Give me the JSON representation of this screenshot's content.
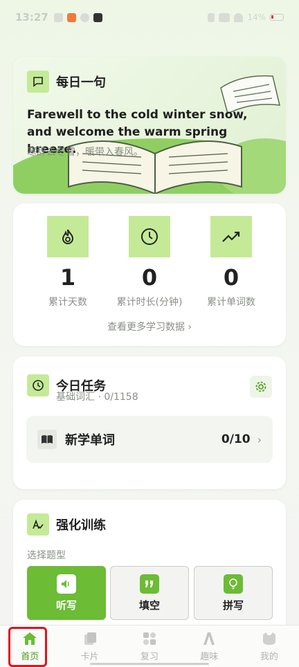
{
  "status_bar": {
    "time": "13:27",
    "battery": "14%"
  },
  "daily": {
    "title": "每日一句",
    "english": "Farewell to the cold winter snow, and welcome the warm spring breeze.",
    "chinese": "寒辞去冬雪，暖带入春风。"
  },
  "stats": {
    "items": [
      {
        "value": "1",
        "label": "累计天数",
        "icon": "flame-icon"
      },
      {
        "value": "0",
        "label": "累计时长(分钟)",
        "icon": "clock-icon"
      },
      {
        "value": "0",
        "label": "累计单词数",
        "icon": "trend-icon"
      }
    ],
    "more_link": "查看更多学习数据 ›"
  },
  "task": {
    "title": "今日任务",
    "subtitle": "基础词汇 · 0/1158",
    "row_label": "新学单词",
    "row_progress": "0/10"
  },
  "train": {
    "title": "强化训练",
    "choose": "选择题型",
    "buttons": [
      {
        "label": "听写",
        "active": true,
        "icon": "speaker-icon"
      },
      {
        "label": "填空",
        "active": false,
        "icon": "quote-icon"
      },
      {
        "label": "拼写",
        "active": false,
        "icon": "bulb-icon"
      }
    ]
  },
  "nav": {
    "items": [
      {
        "label": "首页",
        "active": true
      },
      {
        "label": "卡片",
        "active": false
      },
      {
        "label": "复习",
        "active": false
      },
      {
        "label": "趣味",
        "active": false
      },
      {
        "label": "我的",
        "active": false
      }
    ]
  },
  "colors": {
    "accent": "#6cbc35",
    "icon_bg": "#c5ea97",
    "highlight": "#e0141b"
  }
}
